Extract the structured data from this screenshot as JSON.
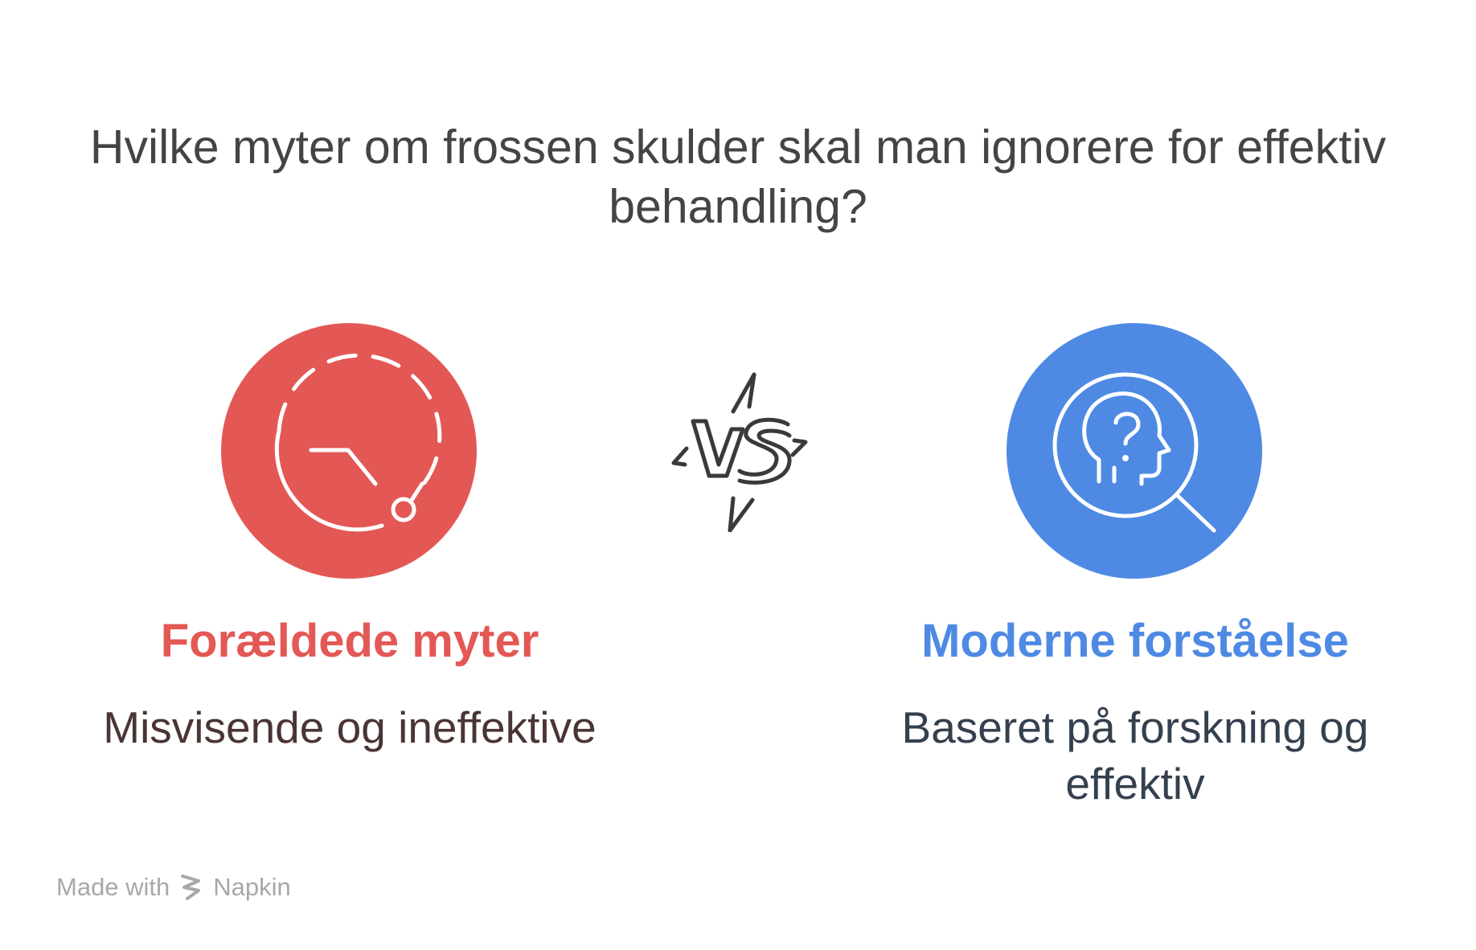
{
  "title": "Hvilke myter om frossen skulder skal man ignorere for effektiv behandling?",
  "vs_icon": "vs-lightning-icon",
  "left": {
    "heading": "Forældede myter",
    "description": "Misvisende og ineffektive",
    "icon": "dashed-timer-icon",
    "circle_color": "#e35855",
    "heading_color": "#e35855",
    "description_color": "#4a3434"
  },
  "right": {
    "heading": "Moderne forståelse",
    "description": "Baseret på forskning og effektiv",
    "icon": "head-question-magnifier-icon",
    "circle_color": "#4e8ae4",
    "heading_color": "#4e8ae4",
    "description_color": "#34404e"
  },
  "footer": {
    "made_with": "Made with",
    "brand": "Napkin"
  }
}
